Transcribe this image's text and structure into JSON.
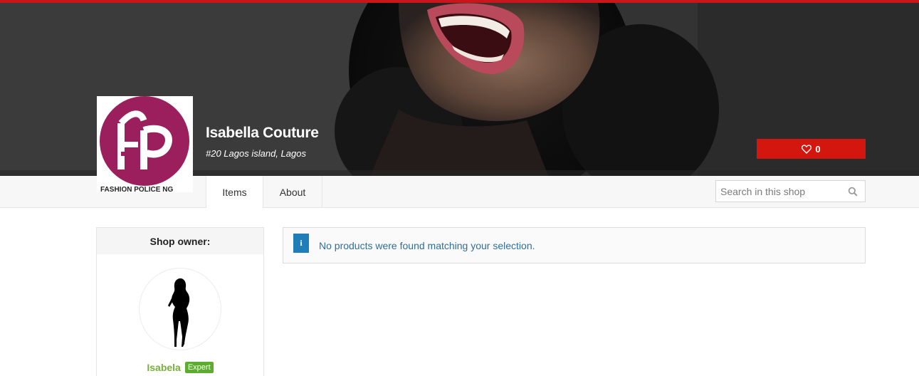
{
  "shop": {
    "name": "Isabella Couture",
    "address": "#20 Lagos island, Lagos",
    "logo_text": "FASHION POLICE NG"
  },
  "favorite": {
    "icon": "heart-outline-icon",
    "count": "0"
  },
  "nav": {
    "tabs": [
      {
        "label": "Items",
        "active": true
      },
      {
        "label": "About",
        "active": false
      }
    ],
    "search": {
      "placeholder": "Search in this shop",
      "value": "",
      "icon": "search-icon"
    }
  },
  "sidebar": {
    "title": "Shop owner:",
    "owner": {
      "name": "Isabela",
      "badge": "Expert"
    }
  },
  "notice": {
    "icon_label": "i",
    "message": "No products were found matching your selection."
  },
  "colors": {
    "accent_red": "#d3170f",
    "top_bar": "#c8161d",
    "logo_purple": "#9b1f5c",
    "owner_green": "#77b13b",
    "badge_green": "#5cac2e",
    "info_blue": "#1f7db8",
    "notice_text": "#2d6f9a"
  }
}
